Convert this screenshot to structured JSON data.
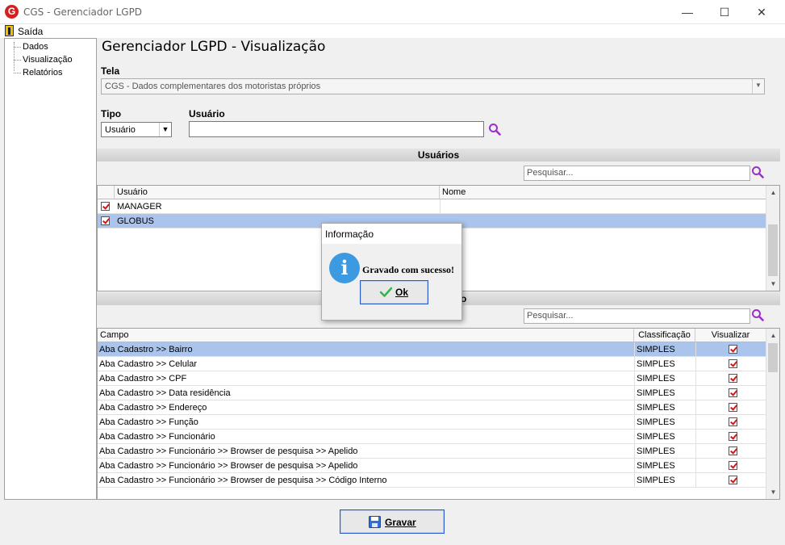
{
  "window": {
    "title": "CGS - Gerenciador LGPD",
    "logo_letter": "G",
    "minimize": "—",
    "maximize": "☐",
    "close": "✕"
  },
  "menu": {
    "exit_label": "Saída"
  },
  "tree": {
    "items": [
      {
        "label": "Dados"
      },
      {
        "label": "Visualização"
      },
      {
        "label": "Relatórios"
      }
    ]
  },
  "page": {
    "title": "Gerenciador LGPD - Visualização",
    "tela_label": "Tela",
    "tela_value": "CGS - Dados complementares dos motoristas próprios",
    "tipo_label": "Tipo",
    "tipo_value": "Usuário",
    "usuario_label": "Usuário",
    "usuario_value": ""
  },
  "users_section": {
    "header": "Usuários",
    "search_placeholder": "Pesquisar...",
    "columns": [
      "Usuário",
      "Nome"
    ],
    "rows": [
      {
        "checked": true,
        "usuario": "MANAGER",
        "nome": "",
        "selected": false
      },
      {
        "checked": true,
        "usuario": "GLOBUS",
        "nome": "",
        "selected": true
      }
    ]
  },
  "fields_section": {
    "header_visible_fragment": "o",
    "search_placeholder": "Pesquisar...",
    "columns": [
      "Campo",
      "Classificação",
      "Visualizar"
    ],
    "rows": [
      {
        "campo": "Aba Cadastro >> Bairro",
        "classificacao": "SIMPLES",
        "visualizar": true,
        "selected": true
      },
      {
        "campo": "Aba Cadastro >> Celular",
        "classificacao": "SIMPLES",
        "visualizar": true,
        "selected": false
      },
      {
        "campo": "Aba Cadastro >> CPF",
        "classificacao": "SIMPLES",
        "visualizar": true,
        "selected": false
      },
      {
        "campo": "Aba Cadastro >> Data residência",
        "classificacao": "SIMPLES",
        "visualizar": true,
        "selected": false
      },
      {
        "campo": "Aba Cadastro >> Endereço",
        "classificacao": "SIMPLES",
        "visualizar": true,
        "selected": false
      },
      {
        "campo": "Aba Cadastro >> Função",
        "classificacao": "SIMPLES",
        "visualizar": true,
        "selected": false
      },
      {
        "campo": "Aba Cadastro >> Funcionário",
        "classificacao": "SIMPLES",
        "visualizar": true,
        "selected": false
      },
      {
        "campo": "Aba Cadastro >> Funcionário >> Browser de pesquisa >> Apelido",
        "classificacao": "SIMPLES",
        "visualizar": true,
        "selected": false
      },
      {
        "campo": "Aba Cadastro >> Funcionário >> Browser de pesquisa >> Apelido",
        "classificacao": "SIMPLES",
        "visualizar": true,
        "selected": false
      },
      {
        "campo": "Aba Cadastro >> Funcionário >> Browser de pesquisa >> Código Interno",
        "classificacao": "SIMPLES",
        "visualizar": true,
        "selected": false
      }
    ]
  },
  "footer": {
    "save_label": "Gravar"
  },
  "dialog": {
    "title": "Informação",
    "icon_glyph": "i",
    "message": "Gravado com sucesso!",
    "ok_label": "Ok"
  },
  "colors": {
    "selection": "#aac4ec",
    "checkmark": "#d01818",
    "info_icon": "#3c9be0",
    "search_icon": "#9b30c8"
  }
}
